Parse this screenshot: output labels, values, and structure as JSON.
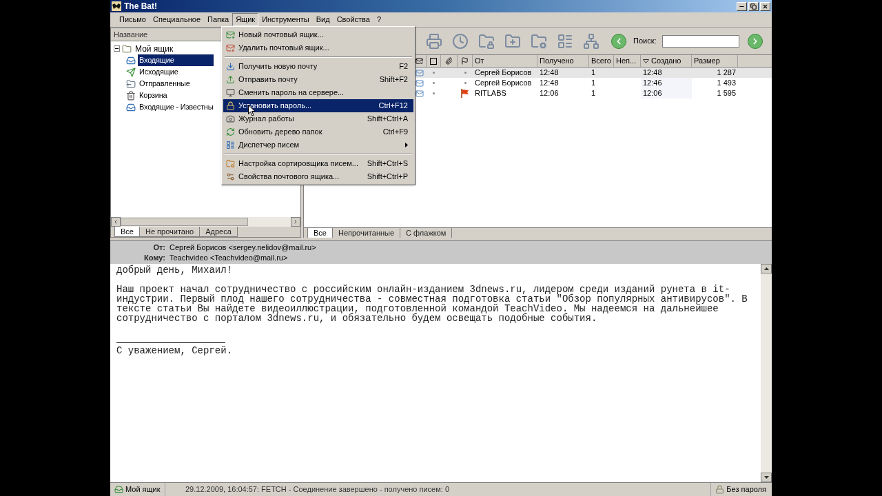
{
  "window": {
    "title": "The Bat!"
  },
  "menu_bar": [
    {
      "label": "Письмо",
      "selected": false
    },
    {
      "label": "Специальное",
      "selected": false
    },
    {
      "label": "Папка",
      "selected": false
    },
    {
      "label": "Ящик",
      "selected": true
    },
    {
      "label": "Инструменты",
      "selected": false
    },
    {
      "label": "Вид",
      "selected": false
    },
    {
      "label": "Свойства",
      "selected": false
    },
    {
      "label": "?",
      "selected": false
    }
  ],
  "dropdown": [
    {
      "kind": "item",
      "label": "Новый почтовый ящик...",
      "selected": false,
      "submenu": false
    },
    {
      "kind": "item",
      "label": "Удалить почтовый ящик...",
      "selected": false,
      "submenu": false
    },
    {
      "kind": "separator"
    },
    {
      "kind": "item",
      "label": "Получить новую почту",
      "shortcut": "F2",
      "selected": false,
      "submenu": false
    },
    {
      "kind": "item",
      "label": "Отправить почту",
      "shortcut": "Shift+F2",
      "selected": false,
      "submenu": false
    },
    {
      "kind": "item",
      "label": "Сменить пароль на сервере...",
      "selected": false,
      "submenu": false
    },
    {
      "kind": "item",
      "label": "Установить пароль...",
      "shortcut": "Ctrl+F12",
      "selected": true,
      "submenu": false
    },
    {
      "kind": "item",
      "label": "Журнал работы",
      "shortcut": "Shift+Ctrl+A",
      "selected": false,
      "submenu": false
    },
    {
      "kind": "item",
      "label": "Обновить дерево папок",
      "shortcut": "Ctrl+F9",
      "selected": false,
      "submenu": false
    },
    {
      "kind": "item",
      "label": "Диспетчер писем",
      "selected": false,
      "submenu": true
    },
    {
      "kind": "separator"
    },
    {
      "kind": "item",
      "label": "Настройка сортировщика писем...",
      "shortcut": "Shift+Ctrl+S",
      "selected": false,
      "submenu": false
    },
    {
      "kind": "item",
      "label": "Свойства почтового ящика...",
      "shortcut": "Shift+Ctrl+P",
      "selected": false,
      "submenu": false
    }
  ],
  "folders": {
    "header": "Название",
    "tree": [
      {
        "label": "Мой ящик",
        "expanded": true,
        "selected": false,
        "children": [
          {
            "label": "Входящие",
            "selected": true
          },
          {
            "label": "Исходящие",
            "selected": false
          },
          {
            "label": "Отправленные",
            "selected": false
          },
          {
            "label": "Корзина",
            "selected": false
          },
          {
            "label": "Входящие - Известны",
            "selected": false
          }
        ]
      }
    ],
    "tabs": [
      {
        "label": "Все",
        "selected": true
      },
      {
        "label": "Не прочитано",
        "selected": false
      },
      {
        "label": "Адреса",
        "selected": false
      }
    ]
  },
  "toolbar": {
    "search_label": "Поиск:"
  },
  "message_list": {
    "columns": [
      {
        "label": "От",
        "sorted": false
      },
      {
        "label": "Получено",
        "sorted": false
      },
      {
        "label": "Всего",
        "sorted": false
      },
      {
        "label": "Неп...",
        "sorted": false
      },
      {
        "label": "Создано",
        "sorted": true
      },
      {
        "label": "Размер",
        "sorted": false
      }
    ],
    "rows": [
      {
        "from": "Сергей Борисов",
        "received": "12:48",
        "total": "1",
        "created": "12:48",
        "size": "1 287",
        "selected": true,
        "flagged": false
      },
      {
        "from": "Сергей Борисов",
        "received": "12:48",
        "total": "1",
        "created": "12:46",
        "size": "1 493",
        "selected": false,
        "flagged": false
      },
      {
        "from": "RITLABS",
        "received": "12:06",
        "total": "1",
        "created": "12:06",
        "size": "1 595",
        "selected": false,
        "flagged": true
      }
    ],
    "tabs": [
      {
        "label": "Все",
        "selected": true
      },
      {
        "label": "Непрочитанные",
        "selected": false
      },
      {
        "label": "С флажком",
        "selected": false
      }
    ]
  },
  "preview": {
    "fields": [
      {
        "label": "От:",
        "value": "Сергей Борисов <sergey.nelidov@mail.ru>"
      },
      {
        "label": "Кому:",
        "value": "Teachvideo <Teachvideo@mail.ru>"
      }
    ],
    "paragraphs": [
      [
        "добрый день, Михаил!"
      ],
      [
        "Наш проект начал сотрудничество с российским онлайн-изданием 3dnews.ru, лидером среди изданий рунета в it-",
        "индустрии. Первый плод нашего сотрудничества - совместная подготовка статьи \"Обзор популярных антивирусов\". В",
        "тексте статьи Вы найдете видеоиллюстрации, подготовленной командой TeachVideo. Мы надеемся на дальнейшее",
        "сотрудничество с порталом 3dnews.ru, и обязательно будем освещать подобные события."
      ]
    ],
    "signature": "С уважением, Сергей."
  },
  "status_bar": {
    "account": "Мой ящик",
    "log": "29.12.2009, 16:04:57: FETCH - Соединение завершено - получено писем: 0",
    "security": "Без пароля"
  }
}
